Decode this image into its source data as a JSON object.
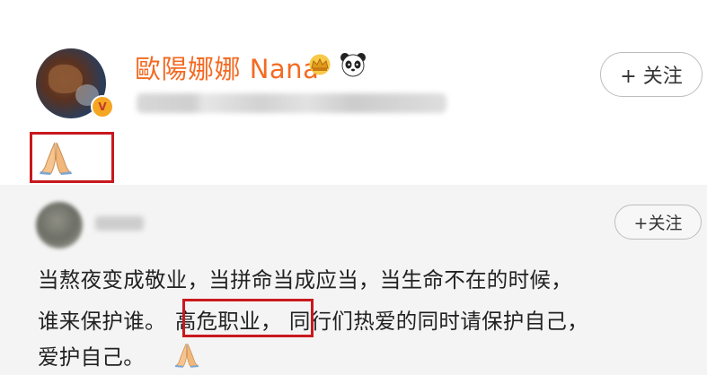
{
  "post": {
    "username": "歐陽娜娜 Nana",
    "follow_label": "+ 关注",
    "emoji": "🙏"
  },
  "comment": {
    "follow_label": "+关注",
    "line1": "当熬夜变成敬业，当拼命当成应当，当生命不在的时候，",
    "line2_a": "谁来保护谁。",
    "line2_highlight": "高危职业，",
    "line2_b": "同行们热爱的同时请保护自己，",
    "line3": "爱护自己。"
  },
  "colors": {
    "username": "#f26b24",
    "highlight_border": "#c8191e",
    "button_border": "#bdbdbd"
  },
  "icons": [
    "crown-icon",
    "panda-icon",
    "verified-badge-icon",
    "praying-hands-icon"
  ]
}
